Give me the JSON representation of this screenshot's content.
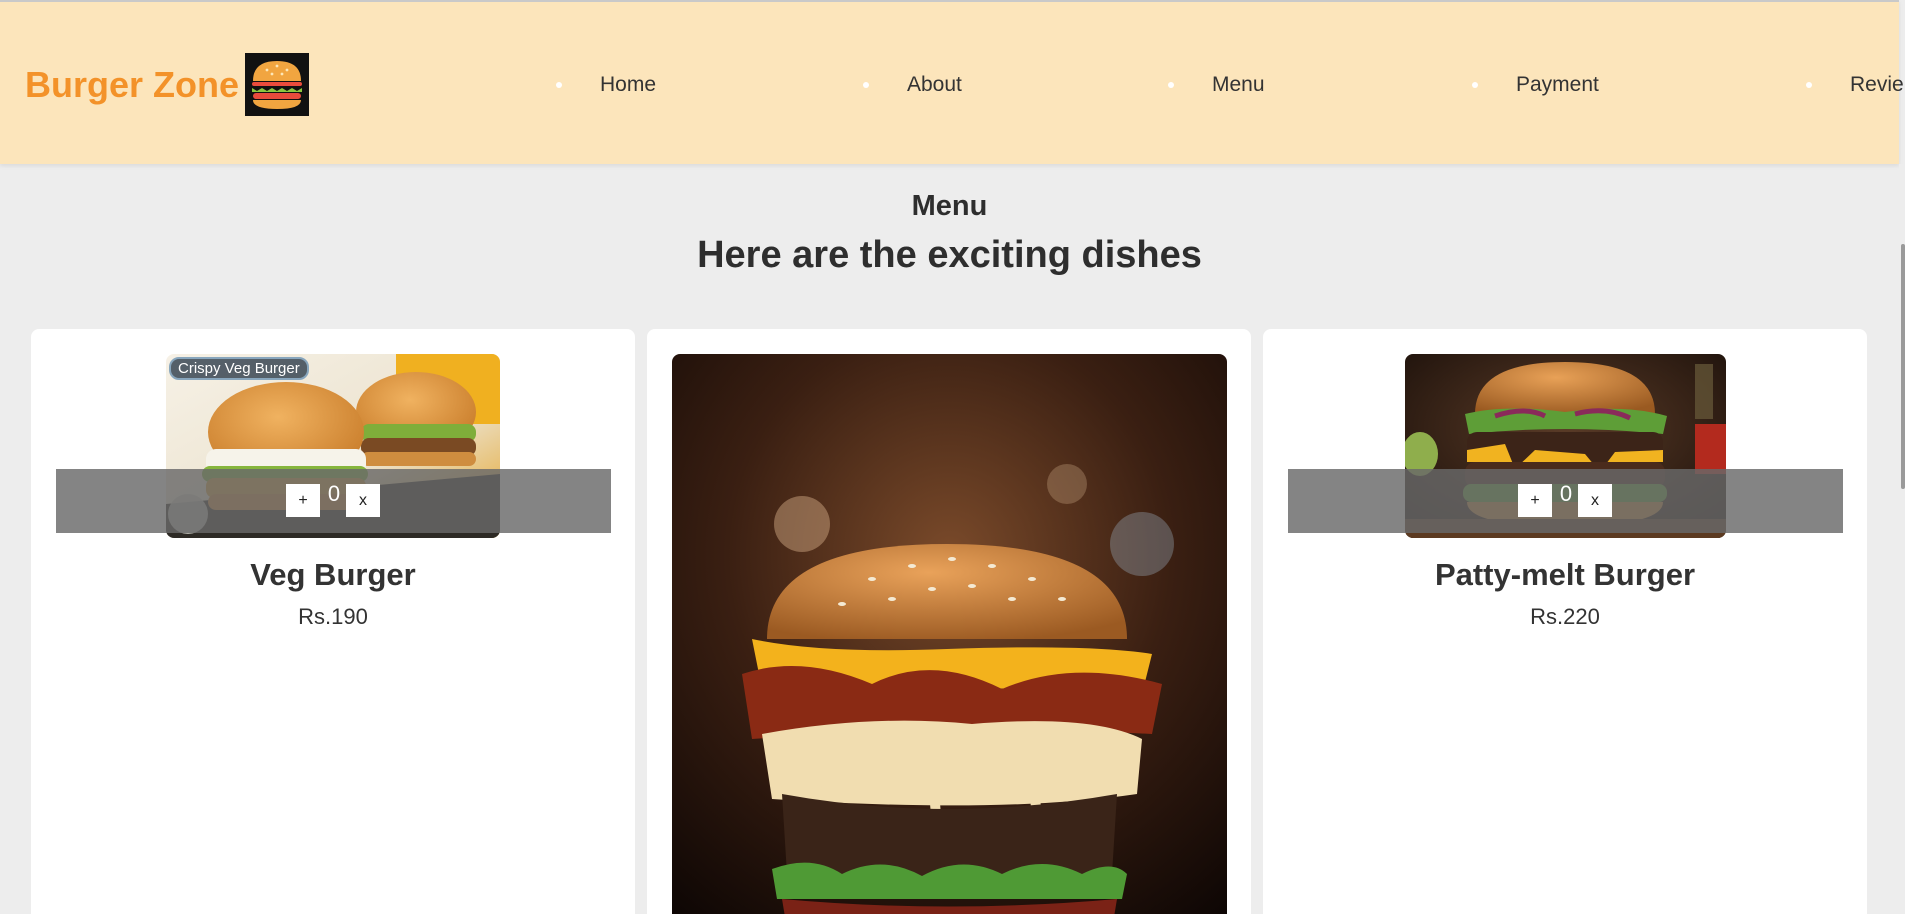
{
  "header": {
    "brand": "Burger Zone",
    "logo_icon": "burger-icon",
    "nav": [
      {
        "label": "Home"
      },
      {
        "label": "About"
      },
      {
        "label": "Menu"
      },
      {
        "label": "Payment"
      },
      {
        "label": "Revie"
      }
    ]
  },
  "menu": {
    "title": "Menu",
    "subtitle": "Here are the exciting dishes"
  },
  "items": [
    {
      "name": "Veg Burger",
      "price": "Rs.190",
      "image_caption": "Crispy Veg Burger",
      "quantity": "0",
      "add_label": "+",
      "remove_label": "x"
    },
    {
      "name": "",
      "price": ""
    },
    {
      "name": "Patty-melt Burger",
      "price": "Rs.220",
      "quantity": "0",
      "add_label": "+",
      "remove_label": "x"
    }
  ],
  "colors": {
    "header_bg": "#fce5bb",
    "brand": "#f39229",
    "page_bg": "#ededed"
  }
}
